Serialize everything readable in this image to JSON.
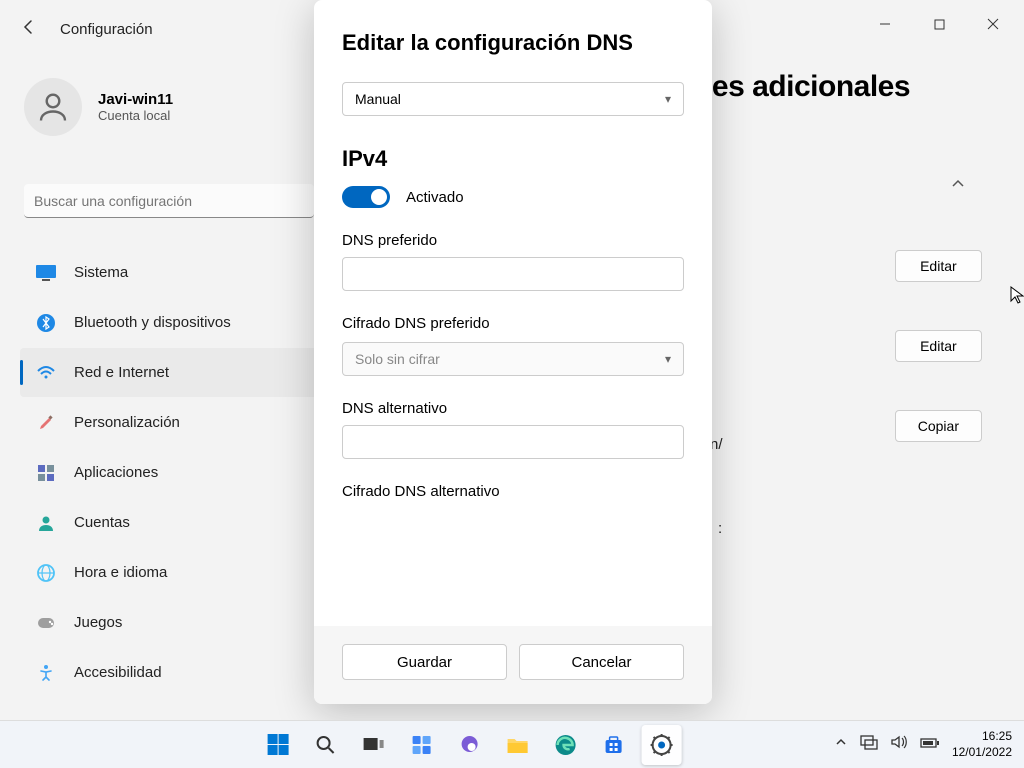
{
  "app": {
    "title": "Configuración"
  },
  "user": {
    "name": "Javi-win11",
    "account_type": "Cuenta local"
  },
  "search": {
    "placeholder": "Buscar una configuración"
  },
  "nav": {
    "items": [
      {
        "label": "Sistema"
      },
      {
        "label": "Bluetooth y dispositivos"
      },
      {
        "label": "Red e Internet"
      },
      {
        "label": "Personalización"
      },
      {
        "label": "Aplicaciones"
      },
      {
        "label": "Cuentas"
      },
      {
        "label": "Hora e idioma"
      },
      {
        "label": "Juegos"
      },
      {
        "label": "Accesibilidad"
      }
    ]
  },
  "main": {
    "heading_fragment": "des adicionales",
    "edit": "Editar",
    "copy": "Copiar",
    "partial1": "n/",
    "partial2": ":"
  },
  "modal": {
    "title": "Editar la configuración DNS",
    "mode_select": "Manual",
    "ipv4_section": "IPv4",
    "toggle_state": "Activado",
    "preferred_dns_label": "DNS preferido",
    "preferred_dns_enc_label": "Cifrado DNS preferido",
    "preferred_dns_enc_value": "Solo sin cifrar",
    "alt_dns_label": "DNS alternativo",
    "alt_dns_enc_label": "Cifrado DNS alternativo",
    "save": "Guardar",
    "cancel": "Cancelar"
  },
  "taskbar": {
    "time": "16:25",
    "date": "12/01/2022"
  }
}
